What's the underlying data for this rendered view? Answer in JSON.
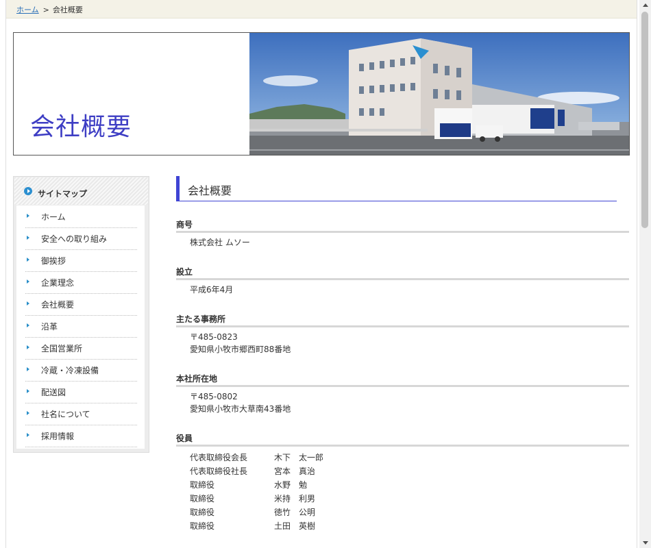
{
  "breadcrumb": {
    "home": "ホーム",
    "separator": ">",
    "current": "会社概要"
  },
  "header": {
    "title": "会社概要"
  },
  "sidebar": {
    "title": "サイトマップ",
    "items": [
      {
        "label": "ホーム"
      },
      {
        "label": "安全への取り組み"
      },
      {
        "label": "御挨拶"
      },
      {
        "label": "企業理念"
      },
      {
        "label": "会社概要"
      },
      {
        "label": "沿革"
      },
      {
        "label": "全国営業所"
      },
      {
        "label": "冷蔵・冷凍設備"
      },
      {
        "label": "配送図"
      },
      {
        "label": "社名について"
      },
      {
        "label": "採用情報"
      }
    ]
  },
  "main": {
    "heading": "会社概要",
    "fields": [
      {
        "label": "商号",
        "lines": [
          "株式会社 ムソー"
        ]
      },
      {
        "label": "設立",
        "lines": [
          "平成6年4月"
        ]
      },
      {
        "label": "主たる事務所",
        "lines": [
          "〒485-0823",
          "愛知県小牧市郷西町88番地"
        ]
      },
      {
        "label": "本社所在地",
        "lines": [
          "〒485-0802",
          "愛知県小牧市大草南43番地"
        ]
      },
      {
        "label": "役員"
      }
    ],
    "officers": [
      {
        "role": "代表取締役会長",
        "name": "木下　太一郎"
      },
      {
        "role": "代表取締役社長",
        "name": "宮本　真治"
      },
      {
        "role": "取締役",
        "name": "水野　勉"
      },
      {
        "role": "取締役",
        "name": "米持　利男"
      },
      {
        "role": "取締役",
        "name": "徳竹　公明"
      },
      {
        "role": "取締役",
        "name": "土田　英樹"
      }
    ]
  },
  "colors": {
    "accent": "#3f44d4",
    "title": "#3e3ec4",
    "link": "#2a6fb8",
    "bullet": "#2a8fc9"
  }
}
